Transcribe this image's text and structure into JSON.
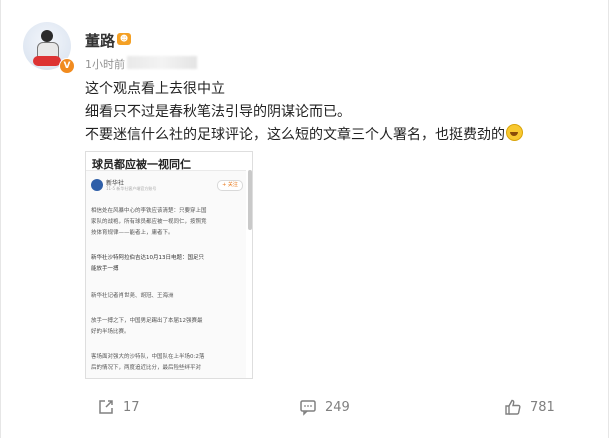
{
  "post": {
    "author": "董路",
    "vip_badge": "VIP",
    "verified_badge": "V",
    "time": "1小时前",
    "lines": [
      "这个观点看上去很中立",
      "细看只不过是春秋笔法引导的阴谋论而已。",
      "不要迷信什么社的足球评论，这么短的文章三个人署名，也挺费劲的"
    ],
    "trailing_emoji": "laughing-emoji"
  },
  "article": {
    "title": "球员都应被一视同仁",
    "source_name": "新华社",
    "source_sub": "11-5 新华社客户端官方账号",
    "follow_label": "+ 关注",
    "lines": [
      "相信处在风暴中心的李铁应该清楚：只要穿上国",
      "家队的战袍，所有球员都应被一视同仁，按照竞",
      "技体育规律——能者上，庸者下。",
      "",
      "新华社沙特阿拉伯吉达10月13日电题：国足只",
      "能放手一搏",
      "",
      "新华社记者肖世尧、胡冠、王海洲",
      "",
      "放手一搏之下，中国男足踢出了本届12强赛最",
      "好的半场比赛。",
      "",
      "客场面对强大的沙特队，中国队在上半场0:2落",
      "后的情况下，两度追近比分，最后险些绊平对"
    ]
  },
  "actions": {
    "share_count": "17",
    "comment_count": "249",
    "like_count": "781"
  },
  "colors": {
    "text": "#222222",
    "meta": "#939393",
    "action": "#808080",
    "badge_orange": "#f18b1f"
  }
}
